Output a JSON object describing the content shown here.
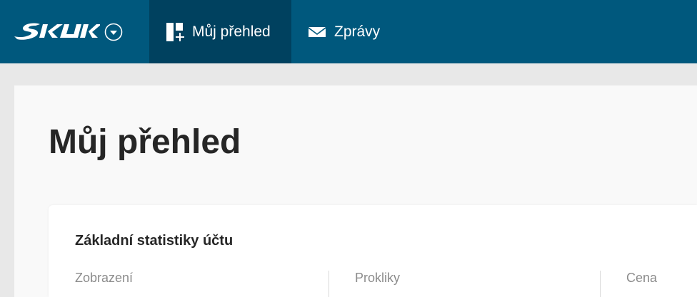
{
  "header": {
    "logo_text": "SKLIK",
    "nav": [
      {
        "label": "Můj přehled",
        "icon": "dashboard-icon",
        "active": true
      },
      {
        "label": "Zprávy",
        "icon": "envelope-icon",
        "active": false
      }
    ]
  },
  "page": {
    "title": "Můj přehled"
  },
  "stats_card": {
    "title": "Základní statistiky účtu",
    "columns": [
      {
        "label": "Zobrazení"
      },
      {
        "label": "Prokliky"
      },
      {
        "label": "Cena"
      }
    ]
  },
  "colors": {
    "header_bg": "#00587d",
    "header_active_bg": "#00415f",
    "page_bg": "#e8e8e8",
    "sheet_bg": "#f9f9f9",
    "card_bg": "#ffffff",
    "title_text": "#262626",
    "muted_text": "#8c8c8c"
  }
}
